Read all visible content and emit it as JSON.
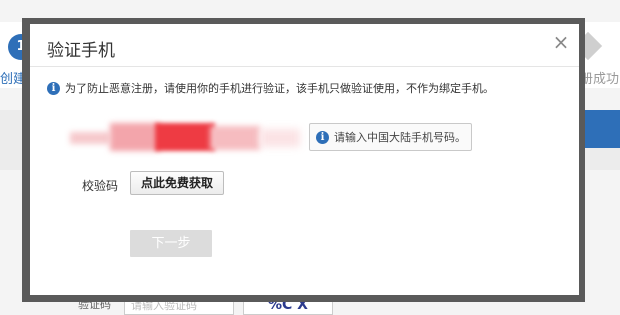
{
  "background": {
    "step1_number": "1",
    "step1_label": "创建账",
    "step_last_label": "册成功",
    "field_label": "验证码",
    "field_placeholder": "请输入验证码",
    "captcha_text": "%C X"
  },
  "dialog": {
    "title": "验证手机",
    "close_icon": "×",
    "notice": "为了防止恶意注册，请使用你的手机进行验证，该手机只做验证使用，不作为绑定手机。",
    "phone_hint": "请输入中国大陆手机号码。",
    "code_label": "校验码",
    "get_code_button": "点此免费获取",
    "next_button": "下一步"
  },
  "colors": {
    "accent": "#2e6fb8",
    "frame": "#5a5a5a",
    "disabled_button": "#dcdcdc",
    "phone_mask_red": "#ee3b43"
  }
}
